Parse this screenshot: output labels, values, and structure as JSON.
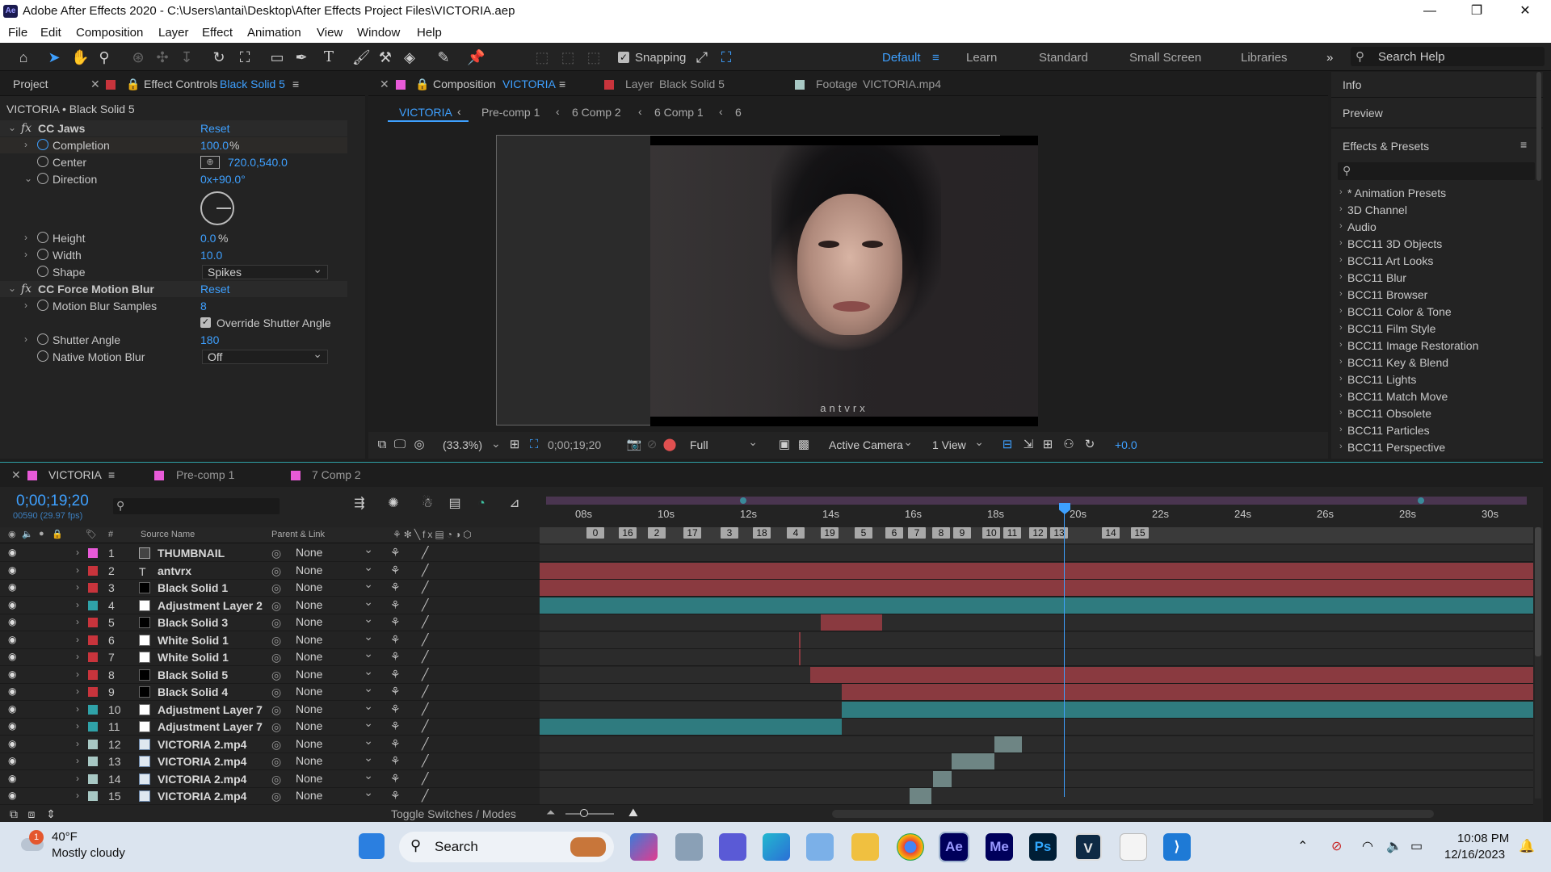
{
  "window": {
    "title": "Adobe After Effects 2020 - C:\\Users\\antai\\Desktop\\After Effects Project Files\\VICTORIA.aep",
    "app_icon": "Ae"
  },
  "menu": [
    "File",
    "Edit",
    "Composition",
    "Layer",
    "Effect",
    "Animation",
    "View",
    "Window",
    "Help"
  ],
  "toolbar": {
    "snapping_label": "Snapping",
    "workspaces": [
      "Default",
      "Learn",
      "Standard",
      "Small Screen",
      "Libraries"
    ],
    "search_placeholder": "Search Help"
  },
  "left_panel": {
    "tab_project": "Project",
    "tab_effect_controls": "Effect Controls",
    "tab_effect_controls_target": "Black Solid 5",
    "header": "VICTORIA • Black Solid 5",
    "effects": [
      {
        "name": "CC Jaws",
        "reset": "Reset"
      },
      {
        "name": "CC Force Motion Blur",
        "reset": "Reset"
      }
    ],
    "jaws_props": {
      "completion_label": "Completion",
      "completion_value": "100.0",
      "center_label": "Center",
      "center_value": "720.0,540.0",
      "direction_label": "Direction",
      "direction_value": "0x+90.0°",
      "height_label": "Height",
      "height_value": "0.0",
      "width_label": "Width",
      "width_value": "10.0",
      "shape_label": "Shape",
      "shape_value": "Spikes"
    },
    "blur_props": {
      "samples_label": "Motion Blur Samples",
      "samples_value": "8",
      "override_label": "Override Shutter Angle",
      "shutter_label": "Shutter Angle",
      "shutter_value": "180",
      "native_label": "Native Motion Blur",
      "native_value": "Off"
    },
    "percent": "%"
  },
  "composition_panel": {
    "tab_composition": "Composition",
    "tab_composition_name": "VICTORIA",
    "tab_layer": "Layer",
    "tab_layer_name": "Black Solid 5",
    "tab_footage": "Footage",
    "tab_footage_name": "VICTORIA.mp4",
    "breadcrumbs": [
      "VICTORIA",
      "Pre-comp 1",
      "6 Comp 2",
      "6 Comp 1",
      "6"
    ],
    "watermark": "antvrx",
    "footer": {
      "zoom": "(33.3%)",
      "timecode": "0;00;19;20",
      "resolution": "Full",
      "camera": "Active Camera",
      "views": "1 View",
      "exposure": "+0.0"
    }
  },
  "right_panel": {
    "info": "Info",
    "preview": "Preview",
    "effects_presets": "Effects & Presets",
    "items": [
      "* Animation Presets",
      "3D Channel",
      "Audio",
      "BCC11 3D Objects",
      "BCC11 Art Looks",
      "BCC11 Blur",
      "BCC11 Browser",
      "BCC11 Color & Tone",
      "BCC11 Film Style",
      "BCC11 Image Restoration",
      "BCC11 Key & Blend",
      "BCC11 Lights",
      "BCC11 Match Move",
      "BCC11 Obsolete",
      "BCC11 Particles",
      "BCC11 Perspective"
    ]
  },
  "timeline": {
    "tabs": [
      "VICTORIA",
      "Pre-comp 1",
      "7 Comp 2"
    ],
    "timecode": "0;00;19;20",
    "frame_info": "00590 (29.97 fps)",
    "col_source_name": "Source Name",
    "col_parent": "Parent & Link",
    "col_hash": "#",
    "ruler_ticks": [
      "08s",
      "10s",
      "12s",
      "14s",
      "16s",
      "18s",
      "20s",
      "22s",
      "24s",
      "26s",
      "28s",
      "30s"
    ],
    "markers": [
      "0",
      "16",
      "2",
      "17",
      "3",
      "18",
      "4",
      "19",
      "5",
      "6",
      "7",
      "8",
      "9",
      "10",
      "11",
      "12",
      "13",
      "14",
      "15"
    ],
    "toggle_label": "Toggle Switches / Modes",
    "layers": [
      {
        "num": "1",
        "name": "THUMBNAIL",
        "label_color": "#e85ad8",
        "icon": "precomp",
        "parent": "None",
        "bar": {
          "color": "#3a3a3a",
          "start": 0,
          "end": 0
        }
      },
      {
        "num": "2",
        "name": "antvrx",
        "label_color": "#c8343c",
        "icon": "text",
        "parent": "None",
        "bar": {
          "color": "#8a3a40",
          "start": 0,
          "end": 1
        }
      },
      {
        "num": "3",
        "name": "Black Solid 1",
        "label_color": "#c8343c",
        "icon": "solid-black",
        "parent": "None",
        "bar": {
          "color": "#8a3a40",
          "start": 0,
          "end": 1
        }
      },
      {
        "num": "4",
        "name": "Adjustment Layer 2",
        "label_color": "#2fa2a8",
        "icon": "solid-white",
        "parent": "None",
        "bar": {
          "color": "#2f7b7f",
          "start": 0,
          "end": 1
        }
      },
      {
        "num": "5",
        "name": "Black Solid 3",
        "label_color": "#c8343c",
        "icon": "solid-black",
        "parent": "None",
        "bar": {
          "color": "#8a3a40",
          "start": 0.283,
          "end": 0.345
        }
      },
      {
        "num": "6",
        "name": "White Solid 1",
        "label_color": "#c8343c",
        "icon": "solid-white",
        "parent": "None",
        "bar": {
          "color": "#8a3a40",
          "start": 0.261,
          "end": 0.263
        }
      },
      {
        "num": "7",
        "name": "White Solid 1",
        "label_color": "#c8343c",
        "icon": "solid-white",
        "parent": "None",
        "bar": {
          "color": "#8a3a40",
          "start": 0.261,
          "end": 0.263
        }
      },
      {
        "num": "8",
        "name": "Black Solid 5",
        "label_color": "#c8343c",
        "icon": "solid-black",
        "parent": "None",
        "bar": {
          "color": "#8a3a40",
          "start": 0.272,
          "end": 1
        }
      },
      {
        "num": "9",
        "name": "Black Solid 4",
        "label_color": "#c8343c",
        "icon": "solid-black",
        "parent": "None",
        "bar": {
          "color": "#8a3a40",
          "start": 0.304,
          "end": 1
        }
      },
      {
        "num": "10",
        "name": "Adjustment Layer 7",
        "label_color": "#2fa2a8",
        "icon": "solid-white",
        "parent": "None",
        "bar": {
          "color": "#2f7b7f",
          "start": 0.304,
          "end": 1
        }
      },
      {
        "num": "11",
        "name": "Adjustment Layer 7",
        "label_color": "#2fa2a8",
        "icon": "solid-white",
        "parent": "None",
        "bar": {
          "color": "#2f7b7f",
          "start": 0,
          "end": 0.304
        }
      },
      {
        "num": "12",
        "name": "VICTORIA 2.mp4",
        "label_color": "#a8c8c4",
        "icon": "footage",
        "parent": "None",
        "bar": {
          "color": "#6e8584",
          "start": 0.458,
          "end": 0.485
        }
      },
      {
        "num": "13",
        "name": "VICTORIA 2.mp4",
        "label_color": "#a8c8c4",
        "icon": "footage",
        "parent": "None",
        "bar": {
          "color": "#6e8584",
          "start": 0.415,
          "end": 0.458
        }
      },
      {
        "num": "14",
        "name": "VICTORIA 2.mp4",
        "label_color": "#a8c8c4",
        "icon": "footage",
        "parent": "None",
        "bar": {
          "color": "#6e8584",
          "start": 0.396,
          "end": 0.415
        }
      },
      {
        "num": "15",
        "name": "VICTORIA 2.mp4",
        "label_color": "#a8c8c4",
        "icon": "footage",
        "parent": "None",
        "bar": {
          "color": "#6e8584",
          "start": 0.372,
          "end": 0.394
        }
      }
    ]
  },
  "taskbar": {
    "weather_temp": "40°F",
    "weather_desc": "Mostly cloudy",
    "weather_badge": "1",
    "search": "Search",
    "apps": [
      "Ae",
      "Me",
      "Ps",
      "V"
    ],
    "time": "10:08 PM",
    "date": "12/16/2023"
  }
}
